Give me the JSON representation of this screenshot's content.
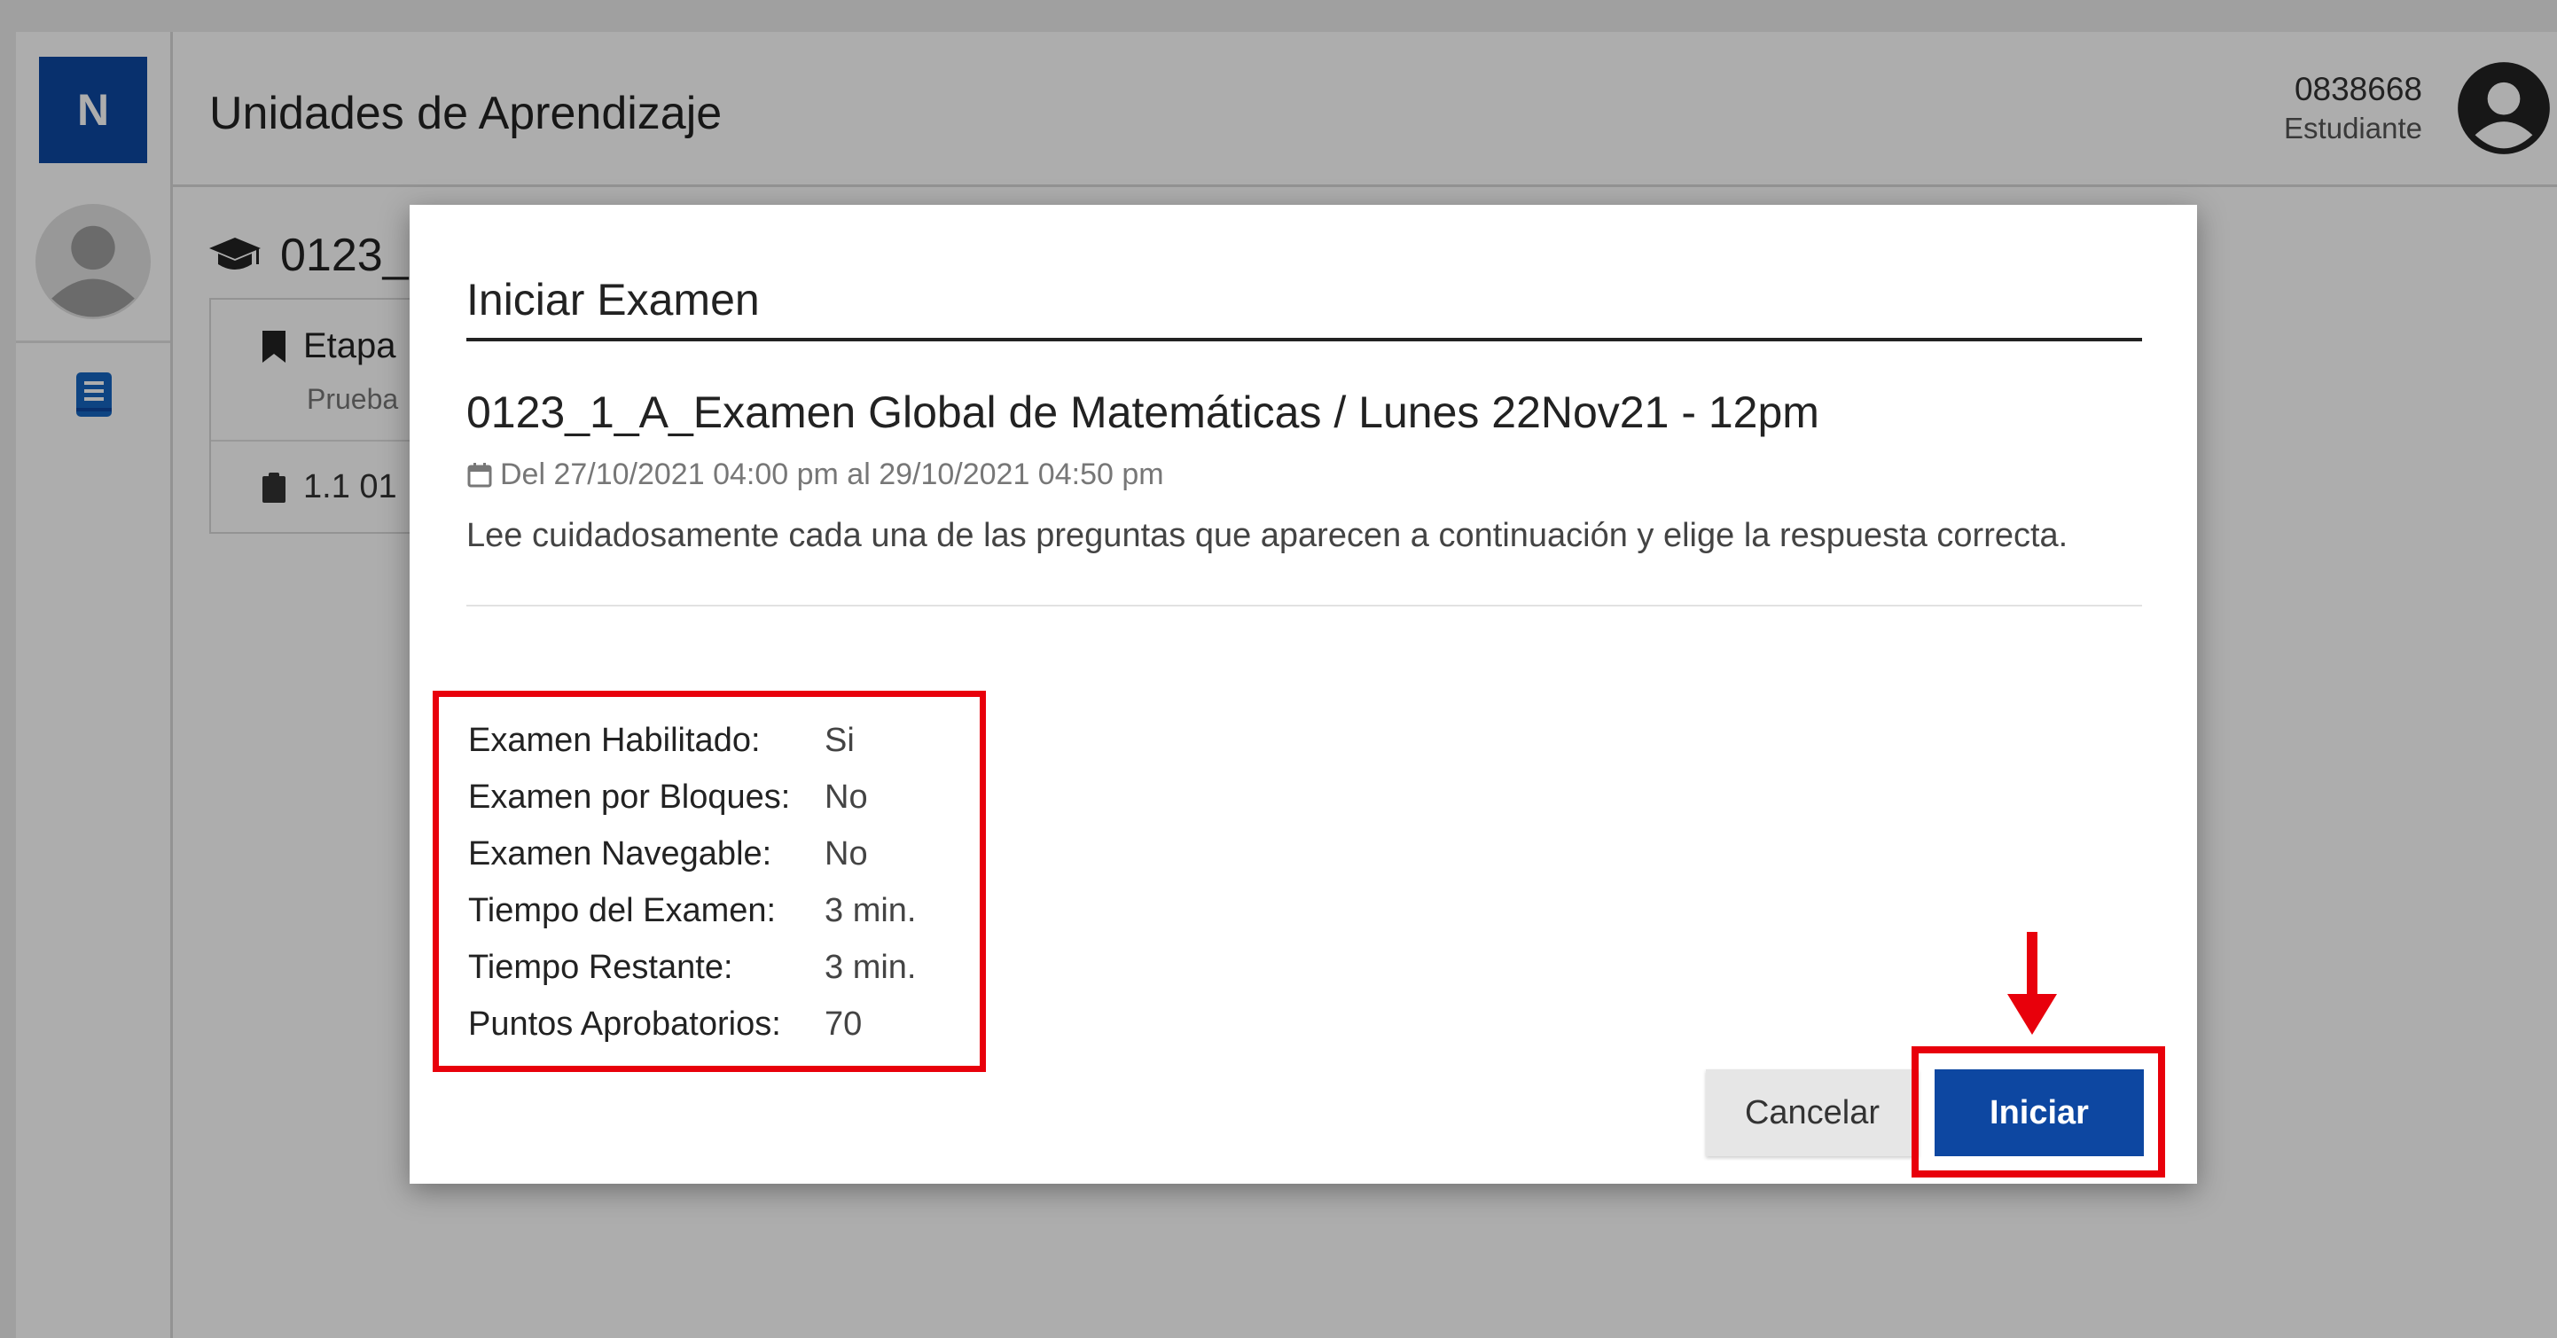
{
  "topbar": {
    "logo_letter": "N",
    "title": "Unidades de Aprendizaje",
    "user_id": "0838668",
    "user_role": "Estudiante"
  },
  "sidebar": {
    "items": [
      {
        "icon": "avatar-icon"
      },
      {
        "icon": "book-icon"
      }
    ]
  },
  "course": {
    "title": "0123_",
    "stage_label": "Etapa",
    "stage_sub": "Prueba",
    "unit_label": "1.1 01"
  },
  "modal": {
    "title": "Iniciar Examen",
    "exam_name": "0123_1_A_Examen Global de Matemáticas / Lunes 22Nov21 - 12pm",
    "date_range": "Del 27/10/2021 04:00 pm al 29/10/2021 04:50 pm",
    "description": "Lee cuidadosamente cada una de las preguntas que aparecen a continuación y elige la respuesta correcta.",
    "info": [
      {
        "label": "Examen Habilitado:",
        "value": "Si"
      },
      {
        "label": "Examen por Bloques:",
        "value": "No"
      },
      {
        "label": "Examen Navegable:",
        "value": "No"
      },
      {
        "label": "Tiempo del Examen:",
        "value": "3 min."
      },
      {
        "label": "Tiempo Restante:",
        "value": "3 min."
      },
      {
        "label": "Puntos Aprobatorios:",
        "value": "70"
      }
    ],
    "cancel_label": "Cancelar",
    "start_label": "Iniciar"
  },
  "colors": {
    "brand": "#0d47a1",
    "highlight": "#e8000b"
  }
}
